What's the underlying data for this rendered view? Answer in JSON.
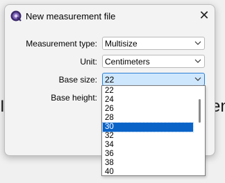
{
  "dialog": {
    "title": "New measurement file",
    "close_glyph": "✕",
    "app_icon": "seamly-app-icon"
  },
  "form": {
    "measurement_type": {
      "label": "Measurement type:",
      "value": "Multisize"
    },
    "unit": {
      "label": "Unit:",
      "value": "Centimeters"
    },
    "base_size": {
      "label": "Base size:",
      "value": "22"
    },
    "base_height": {
      "label": "Base height:"
    }
  },
  "dropdown": {
    "options": [
      "22",
      "24",
      "26",
      "28",
      "30",
      "32",
      "34",
      "36",
      "38",
      "40"
    ],
    "selected": "30"
  },
  "background": {
    "left_peek": "I",
    "right_peek": "en"
  },
  "colors": {
    "accent": "#0a64c8",
    "active_combo": "#cfe7fc"
  }
}
